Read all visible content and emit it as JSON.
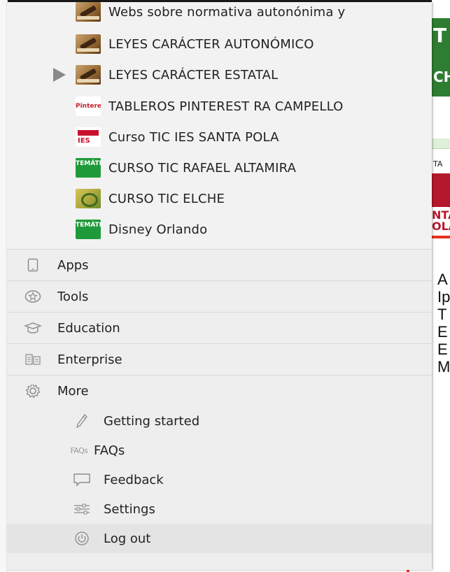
{
  "bookmarks": [
    {
      "label": "Webs sobre normativa autonónima y",
      "thumb": "gavel-icon",
      "arrow": false
    },
    {
      "label": "LEYES CARÁCTER AUTONÓMICO",
      "thumb": "gavel-icon",
      "arrow": false
    },
    {
      "label": "LEYES CARÁCTER ESTATAL",
      "thumb": "gavel-icon",
      "arrow": true
    },
    {
      "label": "TABLEROS PINTEREST RA CAMPELLO",
      "thumb": "pinterest-icon",
      "thumb_text": "Pinterest",
      "arrow": false
    },
    {
      "label": "Curso TIC IES SANTA POLA",
      "thumb": "ies-icon",
      "thumb_text": "IES",
      "arrow": false
    },
    {
      "label": "CURSO TIC RAFAEL ALTAMIRA",
      "thumb": "tematic-icon",
      "thumb_text": "TEMÁTI",
      "arrow": false
    },
    {
      "label": "CURSO TIC ELCHE",
      "thumb": "elche-icon",
      "arrow": false
    },
    {
      "label": "Disney Orlando",
      "thumb": "tematic-icon",
      "thumb_text": "TEMÁTI",
      "arrow": false
    }
  ],
  "nav": [
    {
      "label": "Apps",
      "icon": "tablet-icon"
    },
    {
      "label": "Tools",
      "icon": "star-badge-icon"
    },
    {
      "label": "Education",
      "icon": "graduation-cap-icon"
    },
    {
      "label": "Enterprise",
      "icon": "building-grid-icon"
    },
    {
      "label": "More",
      "icon": "gear-icon"
    }
  ],
  "more_items": [
    {
      "label": "Getting started",
      "icon": "pencil-icon"
    },
    {
      "label": "FAQs",
      "icon": "faqs-icon",
      "icon_text": "FAQs"
    },
    {
      "label": "Feedback",
      "icon": "speech-bubble-icon"
    },
    {
      "label": "Settings",
      "icon": "sliders-icon"
    },
    {
      "label": "Log out",
      "icon": "power-icon"
    }
  ],
  "background_page": {
    "heading_letter": "T",
    "sub_text": "CH",
    "ta_text": "TA",
    "red_text_1": "NTA",
    "red_text_2": "OLA"
  },
  "callout_letters": [
    "A",
    "Ip",
    "T",
    "E",
    "E",
    "M"
  ],
  "colors": {
    "menu_bg": "#eeeeee",
    "accent_red": "#e8321e",
    "green": "#2e7d32"
  }
}
